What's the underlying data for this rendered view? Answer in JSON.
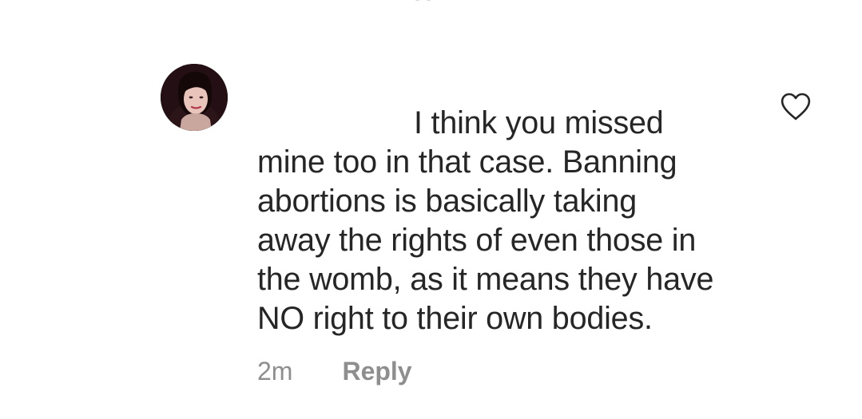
{
  "comment": {
    "avatar_icon": "profile-photo-avatar",
    "text_lines": [
      "I think you missed",
      "mine too in that case. Banning",
      "abortions is basically taking",
      "away the rights of even those in",
      "the womb, as it means they have",
      "NO right to their own bodies."
    ],
    "timestamp": "2m",
    "reply_label": "Reply",
    "like_icon": "heart-outline-icon"
  },
  "colors": {
    "text": "#262626",
    "meta": "#8e8e8e",
    "heart_stroke": "#262626"
  }
}
